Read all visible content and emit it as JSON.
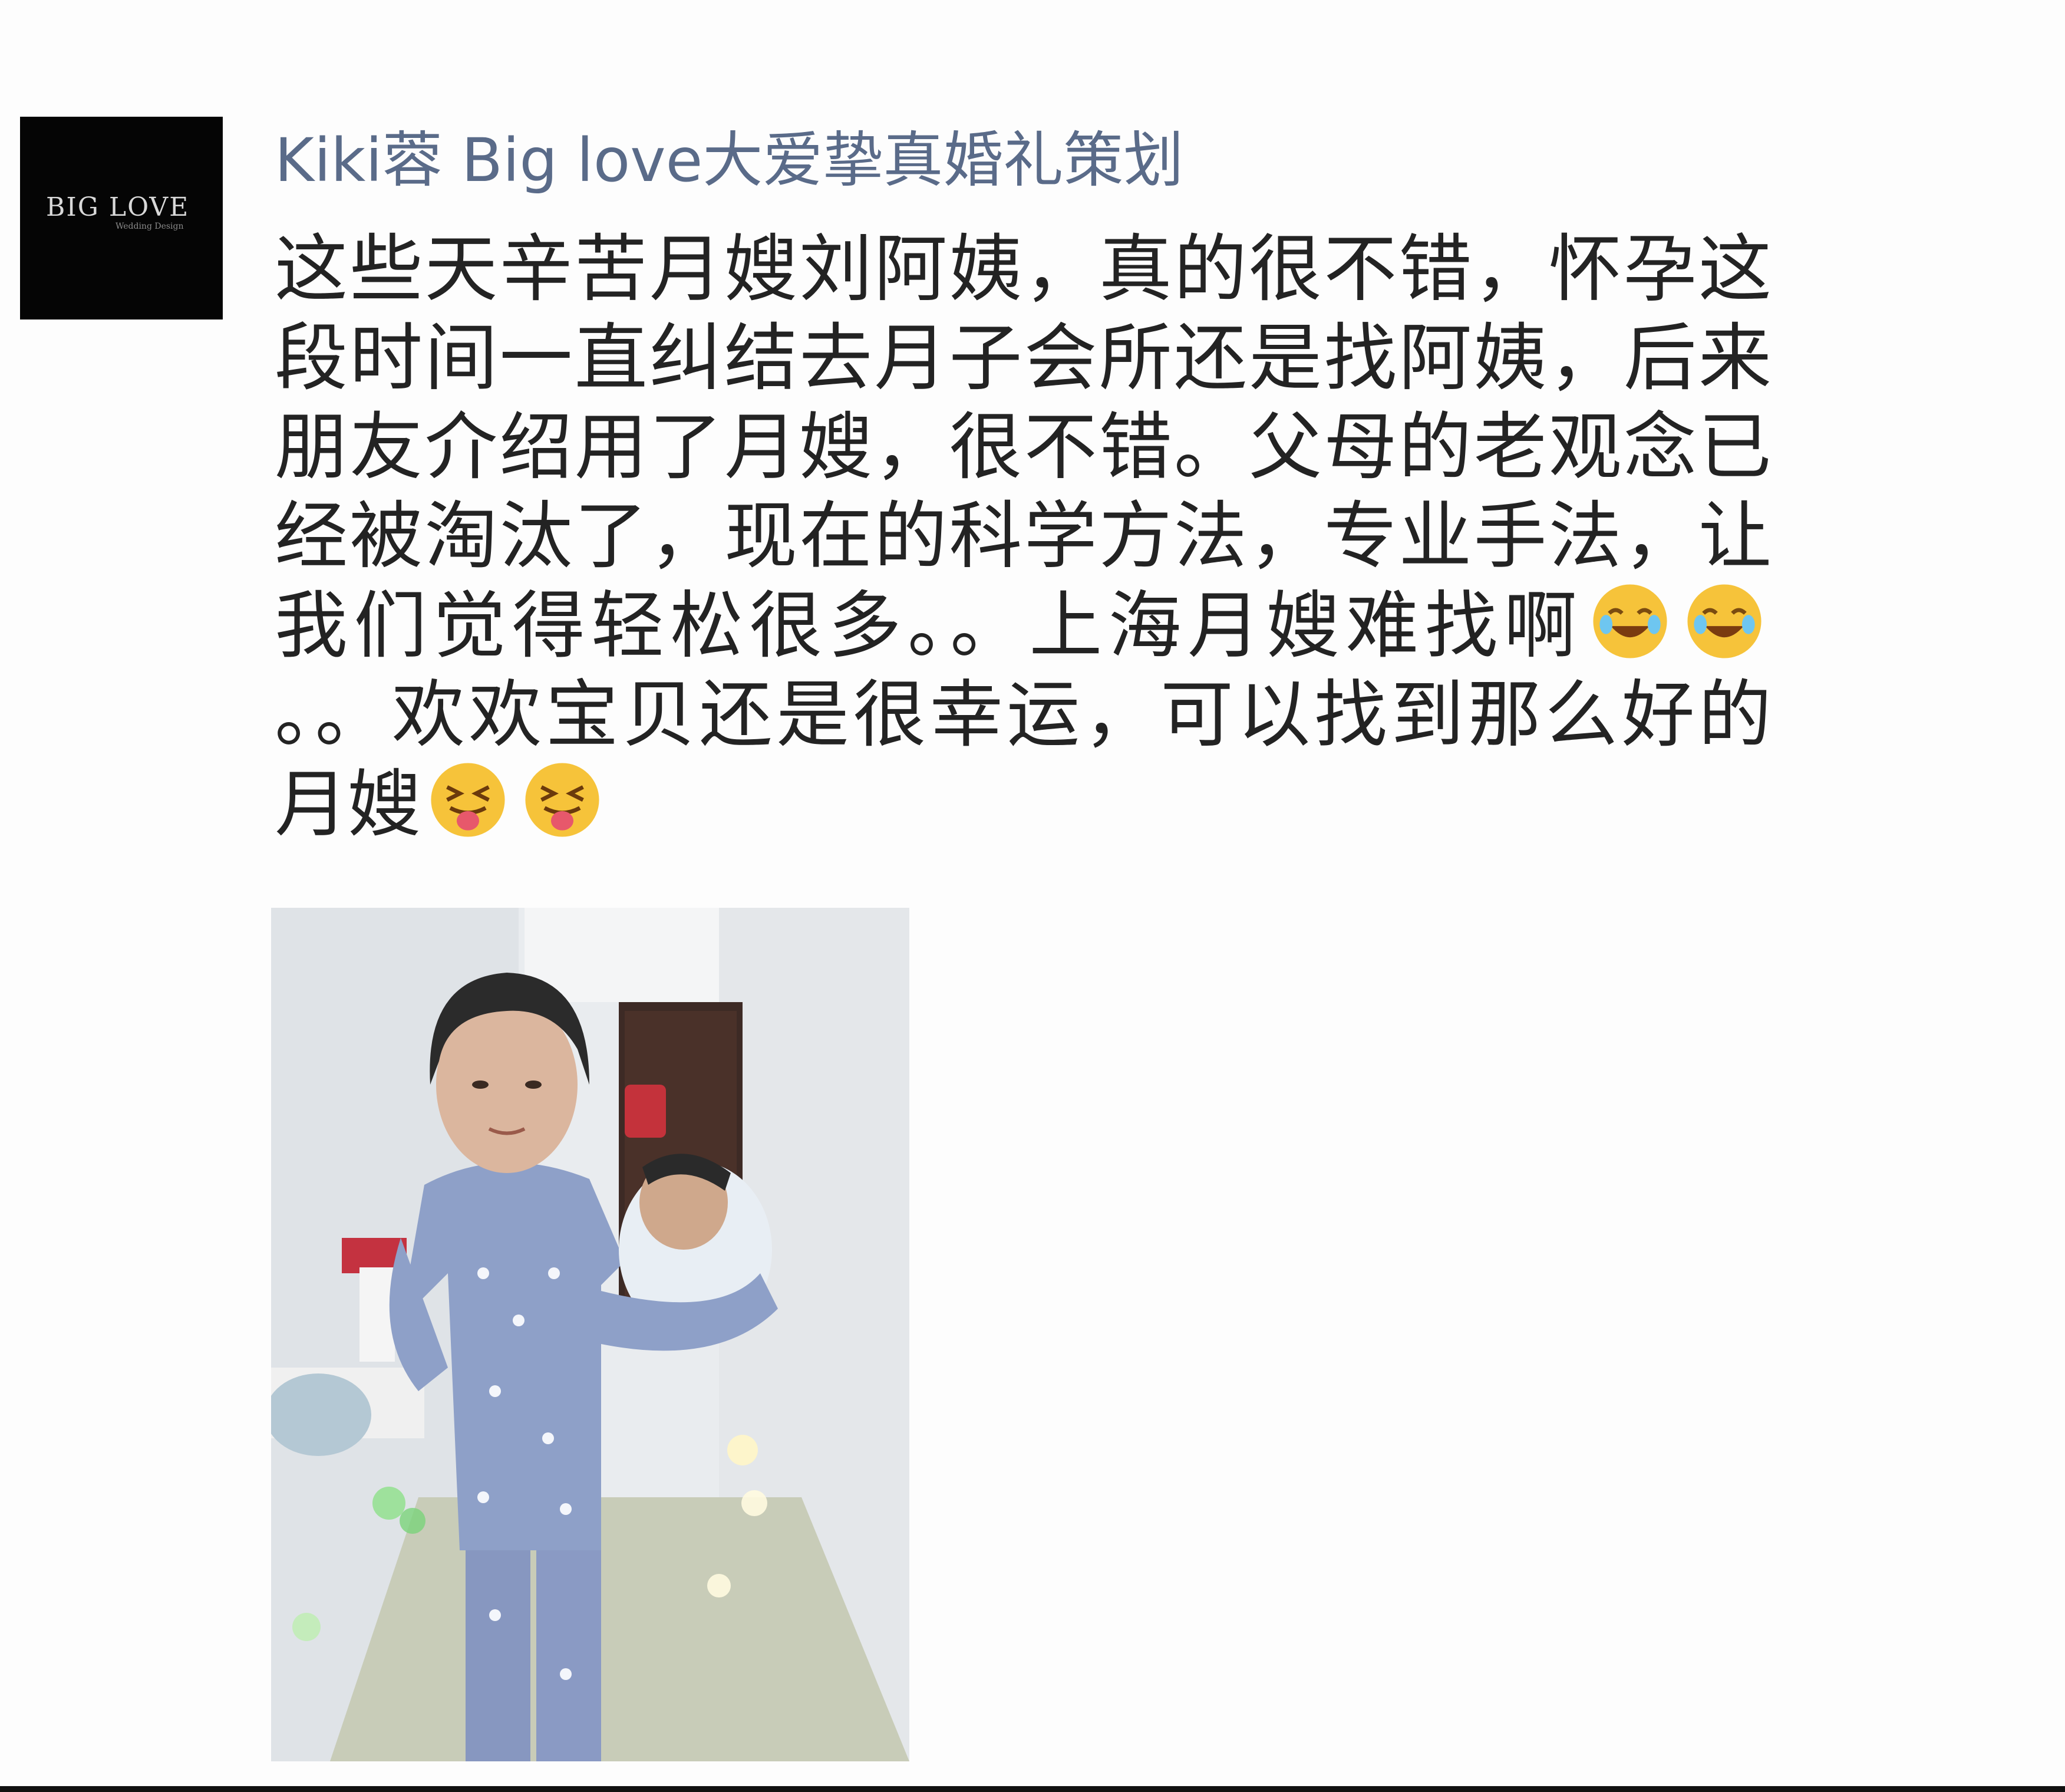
{
  "post": {
    "avatar_logo_text": "BIG LOVE",
    "avatar_logo_sub": "Wedding Design",
    "username": "Kiki蓉 Big love大爱挚真婚礼策划",
    "text_part1": "这些天辛苦月嫂刘阿姨，真的很不错，怀孕这段时间一直纠结去月子会所还是找阿姨，后来朋友介绍用了月嫂，很不错。父母的老观念已经被淘汰了，现在的科学方法，专业手法，让我们觉得轻松很多。。上海月嫂难找啊",
    "text_part2": "。。欢欢宝贝还是很幸运，可以找到那么好的月嫂",
    "emojis_1": [
      "laughing-tears-emoji",
      "laughing-tears-emoji"
    ],
    "emojis_2": [
      "tongue-out-squint-emoji",
      "tongue-out-squint-emoji"
    ]
  },
  "colors": {
    "username": "#5a6b89",
    "text": "#232323",
    "background": "#fdfdfd",
    "avatar_bg": "#050505",
    "pajama": "#8ea0c8"
  }
}
